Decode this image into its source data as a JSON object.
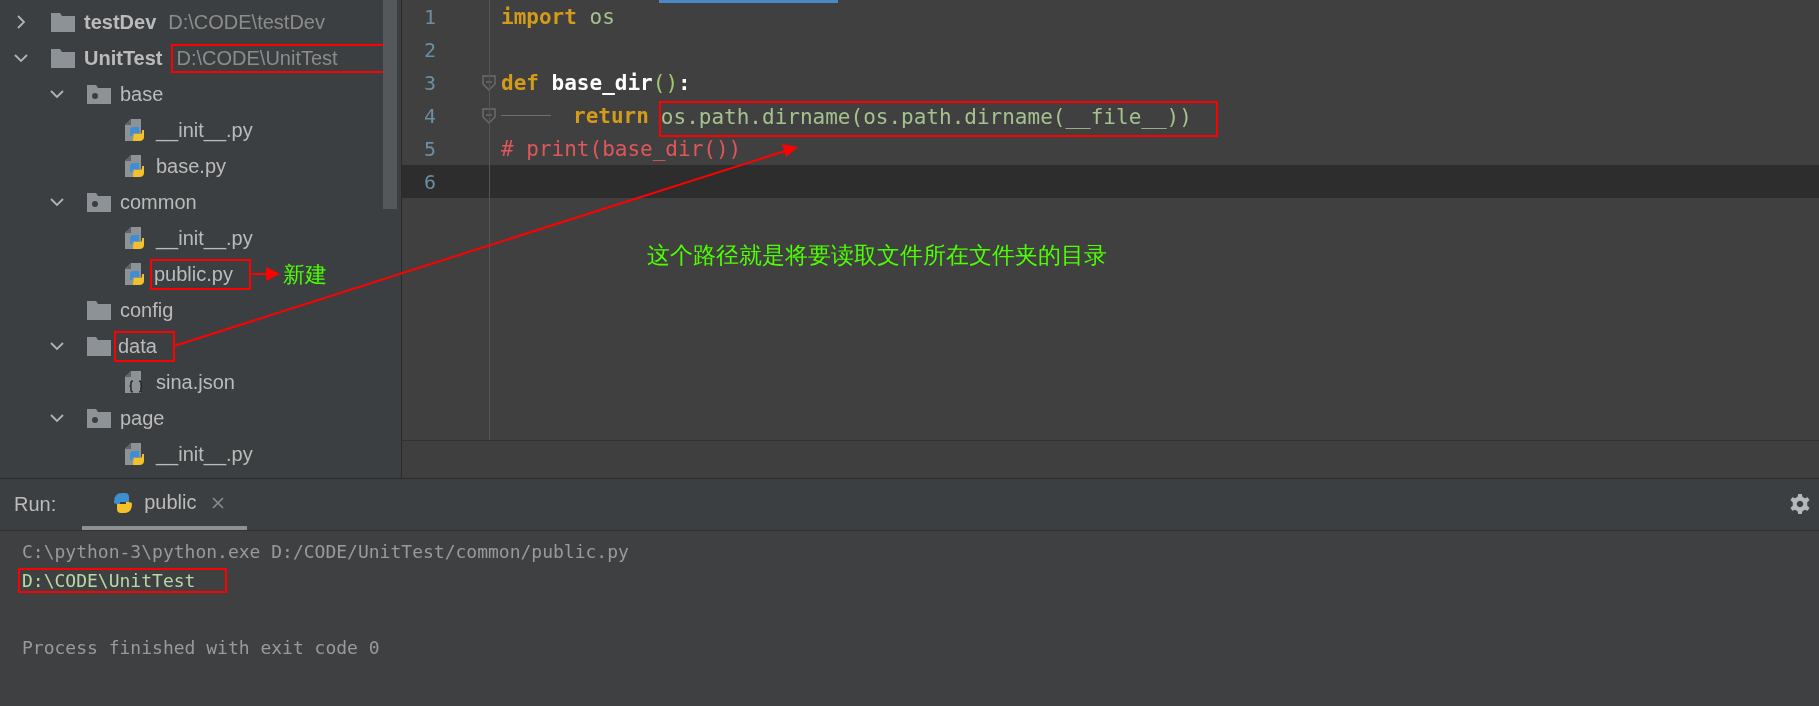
{
  "project_tree": [
    {
      "name": "testDev",
      "path": "D:\\CODE\\testDev",
      "kind": "root",
      "expanded": false,
      "boxed": false
    },
    {
      "name": "UnitTest",
      "path": "D:\\CODE\\UnitTest",
      "kind": "root",
      "expanded": true,
      "boxed": true,
      "children": [
        {
          "name": "base",
          "kind": "package",
          "expanded": true,
          "boxed": false,
          "children": [
            {
              "name": "__init__.py",
              "kind": "python",
              "boxed": false
            },
            {
              "name": "base.py",
              "kind": "python",
              "boxed": false
            }
          ]
        },
        {
          "name": "common",
          "kind": "package",
          "expanded": true,
          "boxed": false,
          "children": [
            {
              "name": "__init__.py",
              "kind": "python",
              "boxed": false
            },
            {
              "name": "public.py",
              "kind": "python",
              "boxed": true
            }
          ]
        },
        {
          "name": "config",
          "kind": "folder",
          "boxed": false
        },
        {
          "name": "data",
          "kind": "folder",
          "expanded": true,
          "boxed": true,
          "children": [
            {
              "name": "sina.json",
              "kind": "json",
              "boxed": false
            }
          ]
        },
        {
          "name": "page",
          "kind": "package",
          "expanded": true,
          "boxed": false,
          "children": [
            {
              "name": "__init__.py",
              "kind": "python",
              "boxed": false
            }
          ]
        }
      ]
    }
  ],
  "editor": {
    "lines": [
      {
        "number": "1",
        "current": false,
        "tokens": [
          {
            "kind": "keyword",
            "text": "import"
          },
          {
            "kind": "plain",
            "text": " os"
          }
        ]
      },
      {
        "number": "2",
        "current": false
      },
      {
        "number": "3",
        "current": false,
        "fold": true,
        "tokens": [
          {
            "kind": "keyword",
            "text": "def"
          },
          {
            "kind": "function",
            "text": " base_dir"
          },
          {
            "kind": "paren",
            "text": "()"
          },
          {
            "kind": "punct",
            "text": ":"
          }
        ]
      },
      {
        "number": "4",
        "current": false,
        "fold": true,
        "tokens": [
          {
            "kind": "tab"
          },
          {
            "kind": "keyword",
            "text": "return"
          },
          {
            "kind": "plain",
            "text": "os.path.dirname(os.path.dirname(__file__))",
            "boxed": true
          }
        ]
      },
      {
        "number": "5",
        "current": false,
        "tokens": [
          {
            "kind": "comment",
            "text": "# print(base_dir())"
          }
        ]
      },
      {
        "number": "6",
        "current": true
      }
    ]
  },
  "run_panel": {
    "label": "Run:",
    "tabs": [
      {
        "label": "public",
        "selected": true
      }
    ],
    "console": [
      {
        "kind": "command",
        "text": "C:\\python-3\\python.exe D:/CODE/UnitTest/common/public.py",
        "boxed": false
      },
      {
        "kind": "output",
        "text": "D:\\CODE\\UnitTest",
        "boxed": true
      },
      {
        "kind": "exit",
        "text": "Process finished with exit code 0",
        "boxed": false
      }
    ]
  },
  "annotations": [
    {
      "kind": "tag",
      "text": "新建"
    },
    {
      "kind": "note",
      "text": "这个路径就是将要读取文件所在文件夹的目录"
    }
  ]
}
